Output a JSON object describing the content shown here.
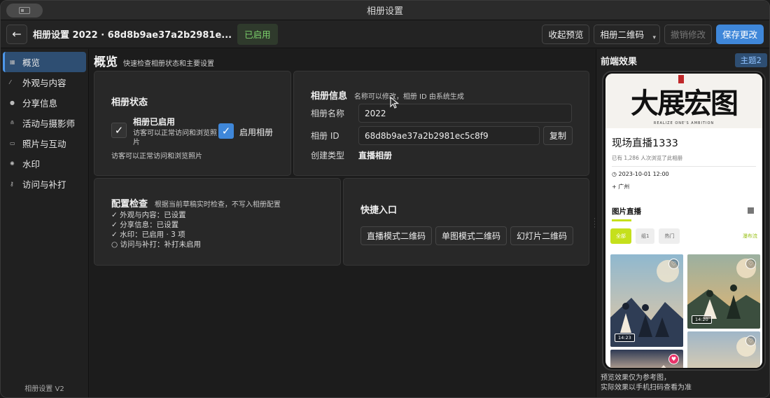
{
  "window": {
    "title": "相册设置"
  },
  "header": {
    "back_label": "←",
    "doc_title": "相册设置 2022 · 68d8b9ae37a2b2981e...",
    "status": "已启用",
    "collapse_preview": "收起预览",
    "album_qr": "相册二维码",
    "undo": "撤销修改",
    "save": "保存更改"
  },
  "sidebar": {
    "items": [
      {
        "label": "概览",
        "icon": "grid-icon"
      },
      {
        "label": "外观与内容",
        "icon": "brush-icon"
      },
      {
        "label": "分享信息",
        "icon": "share-icon"
      },
      {
        "label": "活动与摄影师",
        "icon": "people-icon"
      },
      {
        "label": "照片与互动",
        "icon": "folder-icon"
      },
      {
        "label": "水印",
        "icon": "gear-icon"
      },
      {
        "label": "访问与补打",
        "icon": "key-icon"
      }
    ],
    "version": "相册设置 V2"
  },
  "overview": {
    "title": "概览",
    "subtitle": "快速检查相册状态和主要设置"
  },
  "status_card": {
    "title": "相册状态",
    "enabled_title": "相册已启用",
    "enabled_desc": "访客可以正常访问和浏览照片",
    "enable_label": "启用相册",
    "footer": "访客可以正常访问和浏览照片"
  },
  "info_card": {
    "title": "相册信息",
    "hint": "名称可以修改，相册 ID 由系统生成",
    "name_label": "相册名称",
    "name_value": "2022",
    "id_label": "相册 ID",
    "id_value": "68d8b9ae37a2b2981ec5c8f9",
    "copy_label": "复制",
    "type_label": "创建类型",
    "type_value": "直播相册"
  },
  "check_card": {
    "title": "配置检查",
    "hint": "根据当前草稿实时检查，不写入相册配置",
    "items": [
      "✓ 外观与内容：已设置",
      "✓ 分享信息：已设置",
      "✓ 水印：已启用 · 3 项",
      "○ 访问与补打：补打未启用"
    ]
  },
  "quick_card": {
    "title": "快捷入口",
    "buttons": [
      "直播模式二维码",
      "单图模式二维码",
      "幻灯片二维码"
    ]
  },
  "preview": {
    "title": "前端效果",
    "theme": "主题2",
    "banner_text": "大展宏图",
    "banner_small": "REALIZE ONE'S AMBITION",
    "event_title": "现场直播1333",
    "views": "已有 1,286 人次浏览了此相册",
    "date": "2023-10-01 12:00",
    "location": "广州",
    "tab": "图片直播",
    "filters": [
      "全部",
      "组1",
      "热门"
    ],
    "layout": "瀑布流",
    "photos": [
      {
        "time": "14:23"
      },
      {
        "time": "14:20"
      }
    ],
    "note_line1": "预览效果仅为参考图，",
    "note_line2": "实际效果以手机扫码查看为准"
  },
  "colors": {
    "accent": "#3f87d9",
    "enabled_green": "#7bd16b",
    "preview_accent": "#c5e01c",
    "liked": "#e8336a"
  }
}
